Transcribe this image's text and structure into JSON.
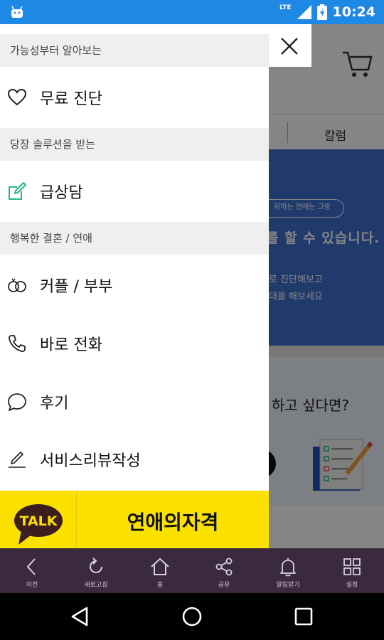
{
  "status_bar": {
    "network": "LTE",
    "time": "10:24"
  },
  "background_page": {
    "tab_label": "칼럼",
    "banner_pill": "희하는 연애는 그랑",
    "banner_headline": "를 할 수 있습니다.",
    "banner_line1": "로 진단해보고",
    "banner_line2": "대를 해보세요",
    "card_question": "하고 싶다면?"
  },
  "drawer": {
    "sections": [
      {
        "header": "가능성부터 알아보는",
        "items": [
          {
            "label": "무료 진단",
            "icon": "heart-icon"
          }
        ]
      },
      {
        "header": "당장 솔루션을 받는",
        "items": [
          {
            "label": "급상담",
            "icon": "edit-icon"
          }
        ]
      },
      {
        "header": "행복한 결혼 / 연애",
        "items": [
          {
            "label": "커플 / 부부",
            "icon": "rings-icon"
          },
          {
            "label": "바로 전화",
            "icon": "phone-icon"
          },
          {
            "label": "후기",
            "icon": "chat-bubble-icon"
          },
          {
            "label": "서비스리뷰작성",
            "icon": "pencil-icon"
          }
        ]
      }
    ],
    "kakao_banner": {
      "logo_text": "TALK",
      "title": "연애의자격"
    }
  },
  "toolbar": {
    "items": [
      {
        "label": "이전",
        "icon": "back-icon"
      },
      {
        "label": "새로고침",
        "icon": "refresh-icon"
      },
      {
        "label": "홈",
        "icon": "home-icon"
      },
      {
        "label": "공유",
        "icon": "share-icon"
      },
      {
        "label": "알림받기",
        "icon": "bell-icon"
      },
      {
        "label": "설정",
        "icon": "grid-icon"
      }
    ]
  },
  "colors": {
    "status_bar": "#1e88e5",
    "toolbar": "#3b2a3d",
    "kakao_yellow": "#fae100",
    "edit_icon_green": "#2bb58c",
    "banner_blue": "#3f6fcf"
  }
}
